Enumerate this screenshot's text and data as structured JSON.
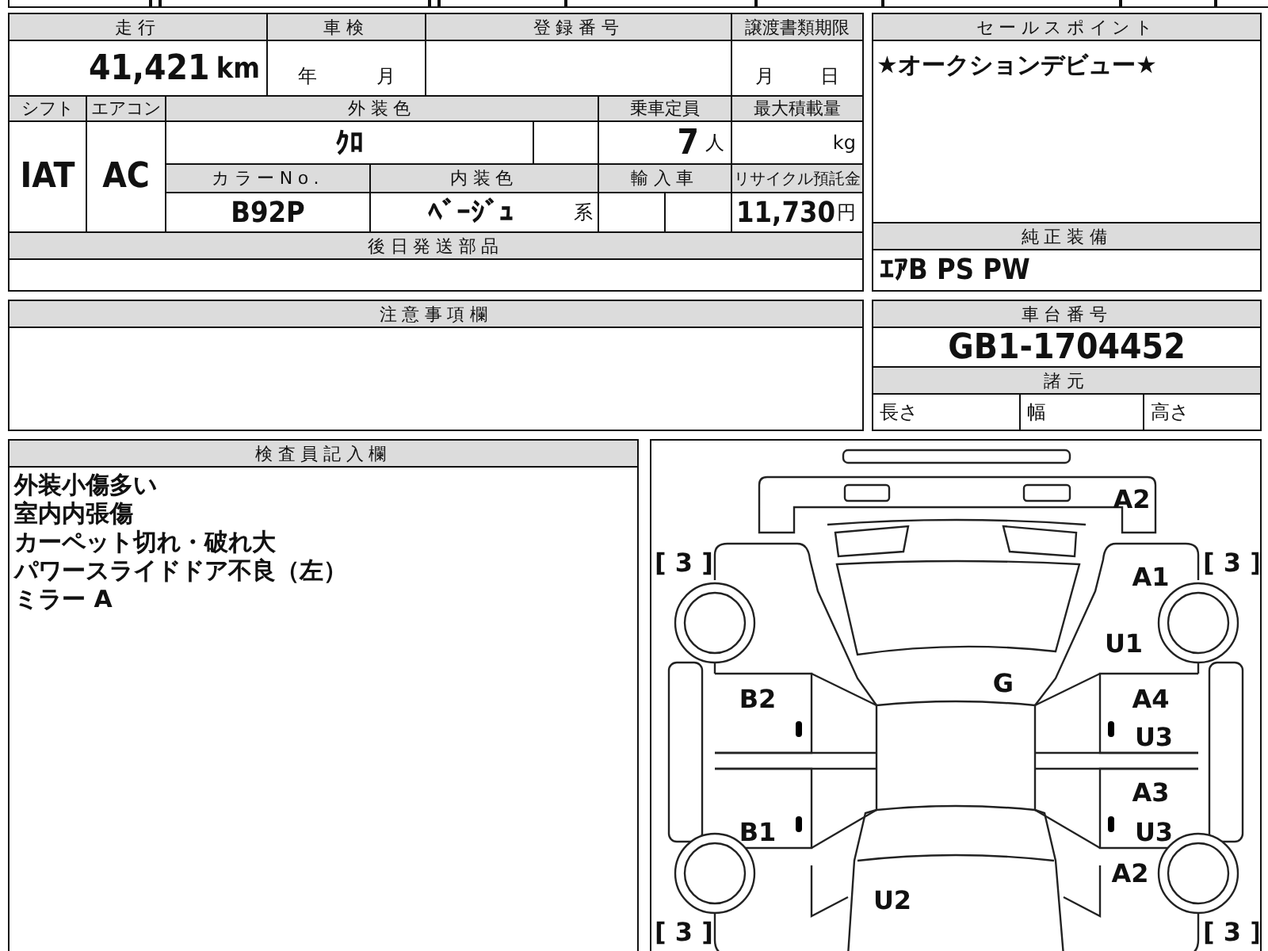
{
  "mileage": {
    "label": "走行",
    "value": "41,421",
    "unit": "km"
  },
  "inspection": {
    "label": "車検",
    "year_unit": "年",
    "month_unit": "月"
  },
  "registration": {
    "label": "登録番号"
  },
  "transfer_deadline": {
    "label": "譲渡書類期限",
    "month_unit": "月",
    "day_unit": "日"
  },
  "shift": {
    "label": "シフト",
    "value": "IAT"
  },
  "aircon": {
    "label": "エアコン",
    "value": "AC"
  },
  "exterior_color": {
    "label": "外装色",
    "value": "ｸﾛ"
  },
  "capacity": {
    "label": "乗車定員",
    "value": "7",
    "unit": "人"
  },
  "max_load": {
    "label": "最大積載量",
    "unit": "kg"
  },
  "color_no": {
    "label": "カラーNo.",
    "value": "B92P"
  },
  "interior_color": {
    "label": "内装色",
    "value": "ﾍﾞｰｼﾞｭ",
    "suffix": "系"
  },
  "import_car": {
    "label": "輸入車"
  },
  "recycle_fee": {
    "label": "リサイクル預託金",
    "value": "11,730",
    "unit": "円"
  },
  "later_parts": {
    "label": "後日発送部品"
  },
  "sale_points": {
    "label": "セールスポイント",
    "text": "★オークションデビュー★"
  },
  "equipment": {
    "label": "純正装備",
    "value": "ｴｱB PS PW"
  },
  "notes": {
    "label": "注意事項欄"
  },
  "chassis": {
    "label": "車台番号",
    "value": "GB1-1704452"
  },
  "specs": {
    "label": "諸元",
    "items": [
      "長さ",
      "幅",
      "高さ"
    ]
  },
  "inspector": {
    "label": "検査員記入欄",
    "lines": [
      "外装小傷多い",
      "室内内張傷",
      "カーペット切れ・破れ大",
      "パワースライドドア不良（左）",
      "ミラー A"
    ]
  },
  "diagram": {
    "marks": [
      "A2",
      "[ 3 ]",
      "A1",
      "[ 3 ]",
      "U1",
      "G",
      "B2",
      "A4",
      "U3",
      "A3",
      "B1",
      "U3",
      "A2",
      "U2",
      "[ 3 ]",
      "[ 3 ]"
    ]
  }
}
